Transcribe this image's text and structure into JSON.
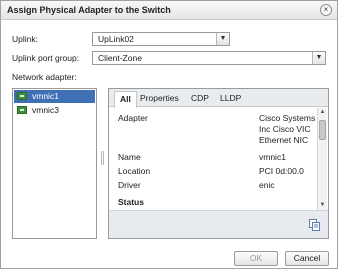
{
  "dialog": {
    "title": "Assign Physical Adapter to the Switch",
    "close_glyph": "×"
  },
  "form": {
    "uplink_label": "Uplink:",
    "uplink_value": "UpLink02",
    "portgroup_label": "Uplink port group:",
    "portgroup_value": "Client-Zone",
    "adapter_label": "Network adapter:",
    "dropdown_glyph": "▼"
  },
  "adapters": [
    {
      "name": "vmnic1",
      "icon": "network-adapter-icon",
      "selected": true
    },
    {
      "name": "vmnic3",
      "icon": "network-adapter-icon",
      "selected": false
    }
  ],
  "tabs": [
    "All",
    "Properties",
    "CDP",
    "LLDP"
  ],
  "details": {
    "adapter_key": "Adapter",
    "adapter_value_lines": [
      "Cisco Systems",
      "Inc Cisco VIC",
      "Ethernet NIC"
    ],
    "name_key": "Name",
    "name_value": "vmnic1",
    "location_key": "Location",
    "location_value": "PCI 0d:00.0",
    "driver_key": "Driver",
    "driver_value": "enic",
    "status_heading": "Status"
  },
  "scroll": {
    "up_glyph": "▲",
    "down_glyph": "▼"
  },
  "buttons": {
    "ok": "OK",
    "cancel": "Cancel"
  },
  "colors": {
    "selection": "#3f6fb5",
    "nic_icon": "#3e8f3e"
  }
}
